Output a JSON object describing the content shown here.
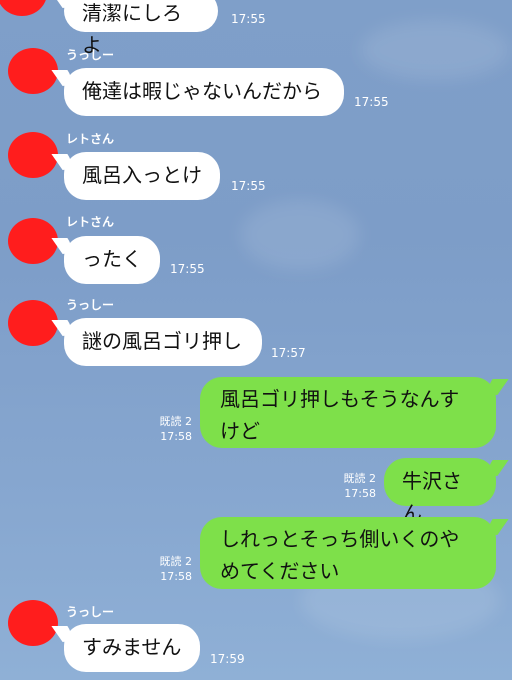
{
  "messages": [
    {
      "sender": "",
      "text": "清潔にしろよ",
      "time": "17:55"
    },
    {
      "sender": "うっしー",
      "text": "俺達は暇じゃないんだから",
      "time": "17:55"
    },
    {
      "sender": "レトさん",
      "text": "風呂入っとけ",
      "time": "17:55"
    },
    {
      "sender": "レトさん",
      "text": "ったく",
      "time": "17:55"
    },
    {
      "sender": "うっしー",
      "text": "謎の風呂ゴリ押し",
      "time": "17:57"
    },
    {
      "text": "風呂ゴリ押しもそうなんすけど",
      "read": "既読 2",
      "time": "17:58"
    },
    {
      "text": "牛沢さん",
      "read": "既読 2",
      "time": "17:58"
    },
    {
      "text": "しれっとそっち側いくのやめてください",
      "read": "既読 2",
      "time": "17:58"
    },
    {
      "sender": "うっしー",
      "text": "すみません",
      "time": "17:59"
    }
  ],
  "colors": {
    "background": "#7f9fc9",
    "incoming_bubble": "#ffffff",
    "outgoing_bubble": "#7ee04a",
    "avatar_redaction": "#ff1d1d"
  }
}
